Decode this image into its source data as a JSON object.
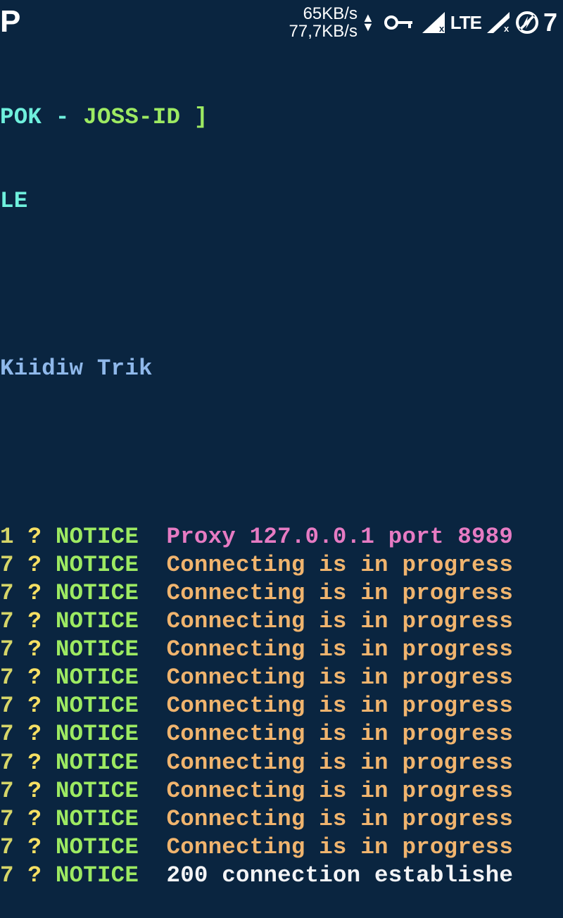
{
  "statusbar": {
    "logo_text": "P",
    "speed_up": "65KB/s",
    "speed_down": "77,7KB/s",
    "lte_label": "LTE",
    "battery_partial": "7"
  },
  "header": {
    "line1_a": "POK - ",
    "line1_b": "JOSS-ID ]",
    "line2": "LE",
    "author": "Kiidiw Trik"
  },
  "log": {
    "entries": [
      {
        "n": "1",
        "msg": "Proxy 127.0.0.1 port 8989",
        "color": "pink"
      },
      {
        "n": "7",
        "msg": "Connecting is in progress",
        "color": "orange"
      },
      {
        "n": "7",
        "msg": "Connecting is in progress",
        "color": "orange"
      },
      {
        "n": "7",
        "msg": "Connecting is in progress",
        "color": "orange"
      },
      {
        "n": "7",
        "msg": "Connecting is in progress",
        "color": "orange"
      },
      {
        "n": "7",
        "msg": "Connecting is in progress",
        "color": "orange"
      },
      {
        "n": "7",
        "msg": "Connecting is in progress",
        "color": "orange"
      },
      {
        "n": "7",
        "msg": "Connecting is in progress",
        "color": "orange"
      },
      {
        "n": "7",
        "msg": "Connecting is in progress",
        "color": "orange"
      },
      {
        "n": "7",
        "msg": "Connecting is in progress",
        "color": "orange"
      },
      {
        "n": "7",
        "msg": "Connecting is in progress",
        "color": "orange"
      },
      {
        "n": "7",
        "msg": "Connecting is in progress",
        "color": "orange"
      },
      {
        "n": "7",
        "msg": "200 connection establishe",
        "color": "white"
      }
    ],
    "q": "?",
    "level": "NOTICE"
  }
}
